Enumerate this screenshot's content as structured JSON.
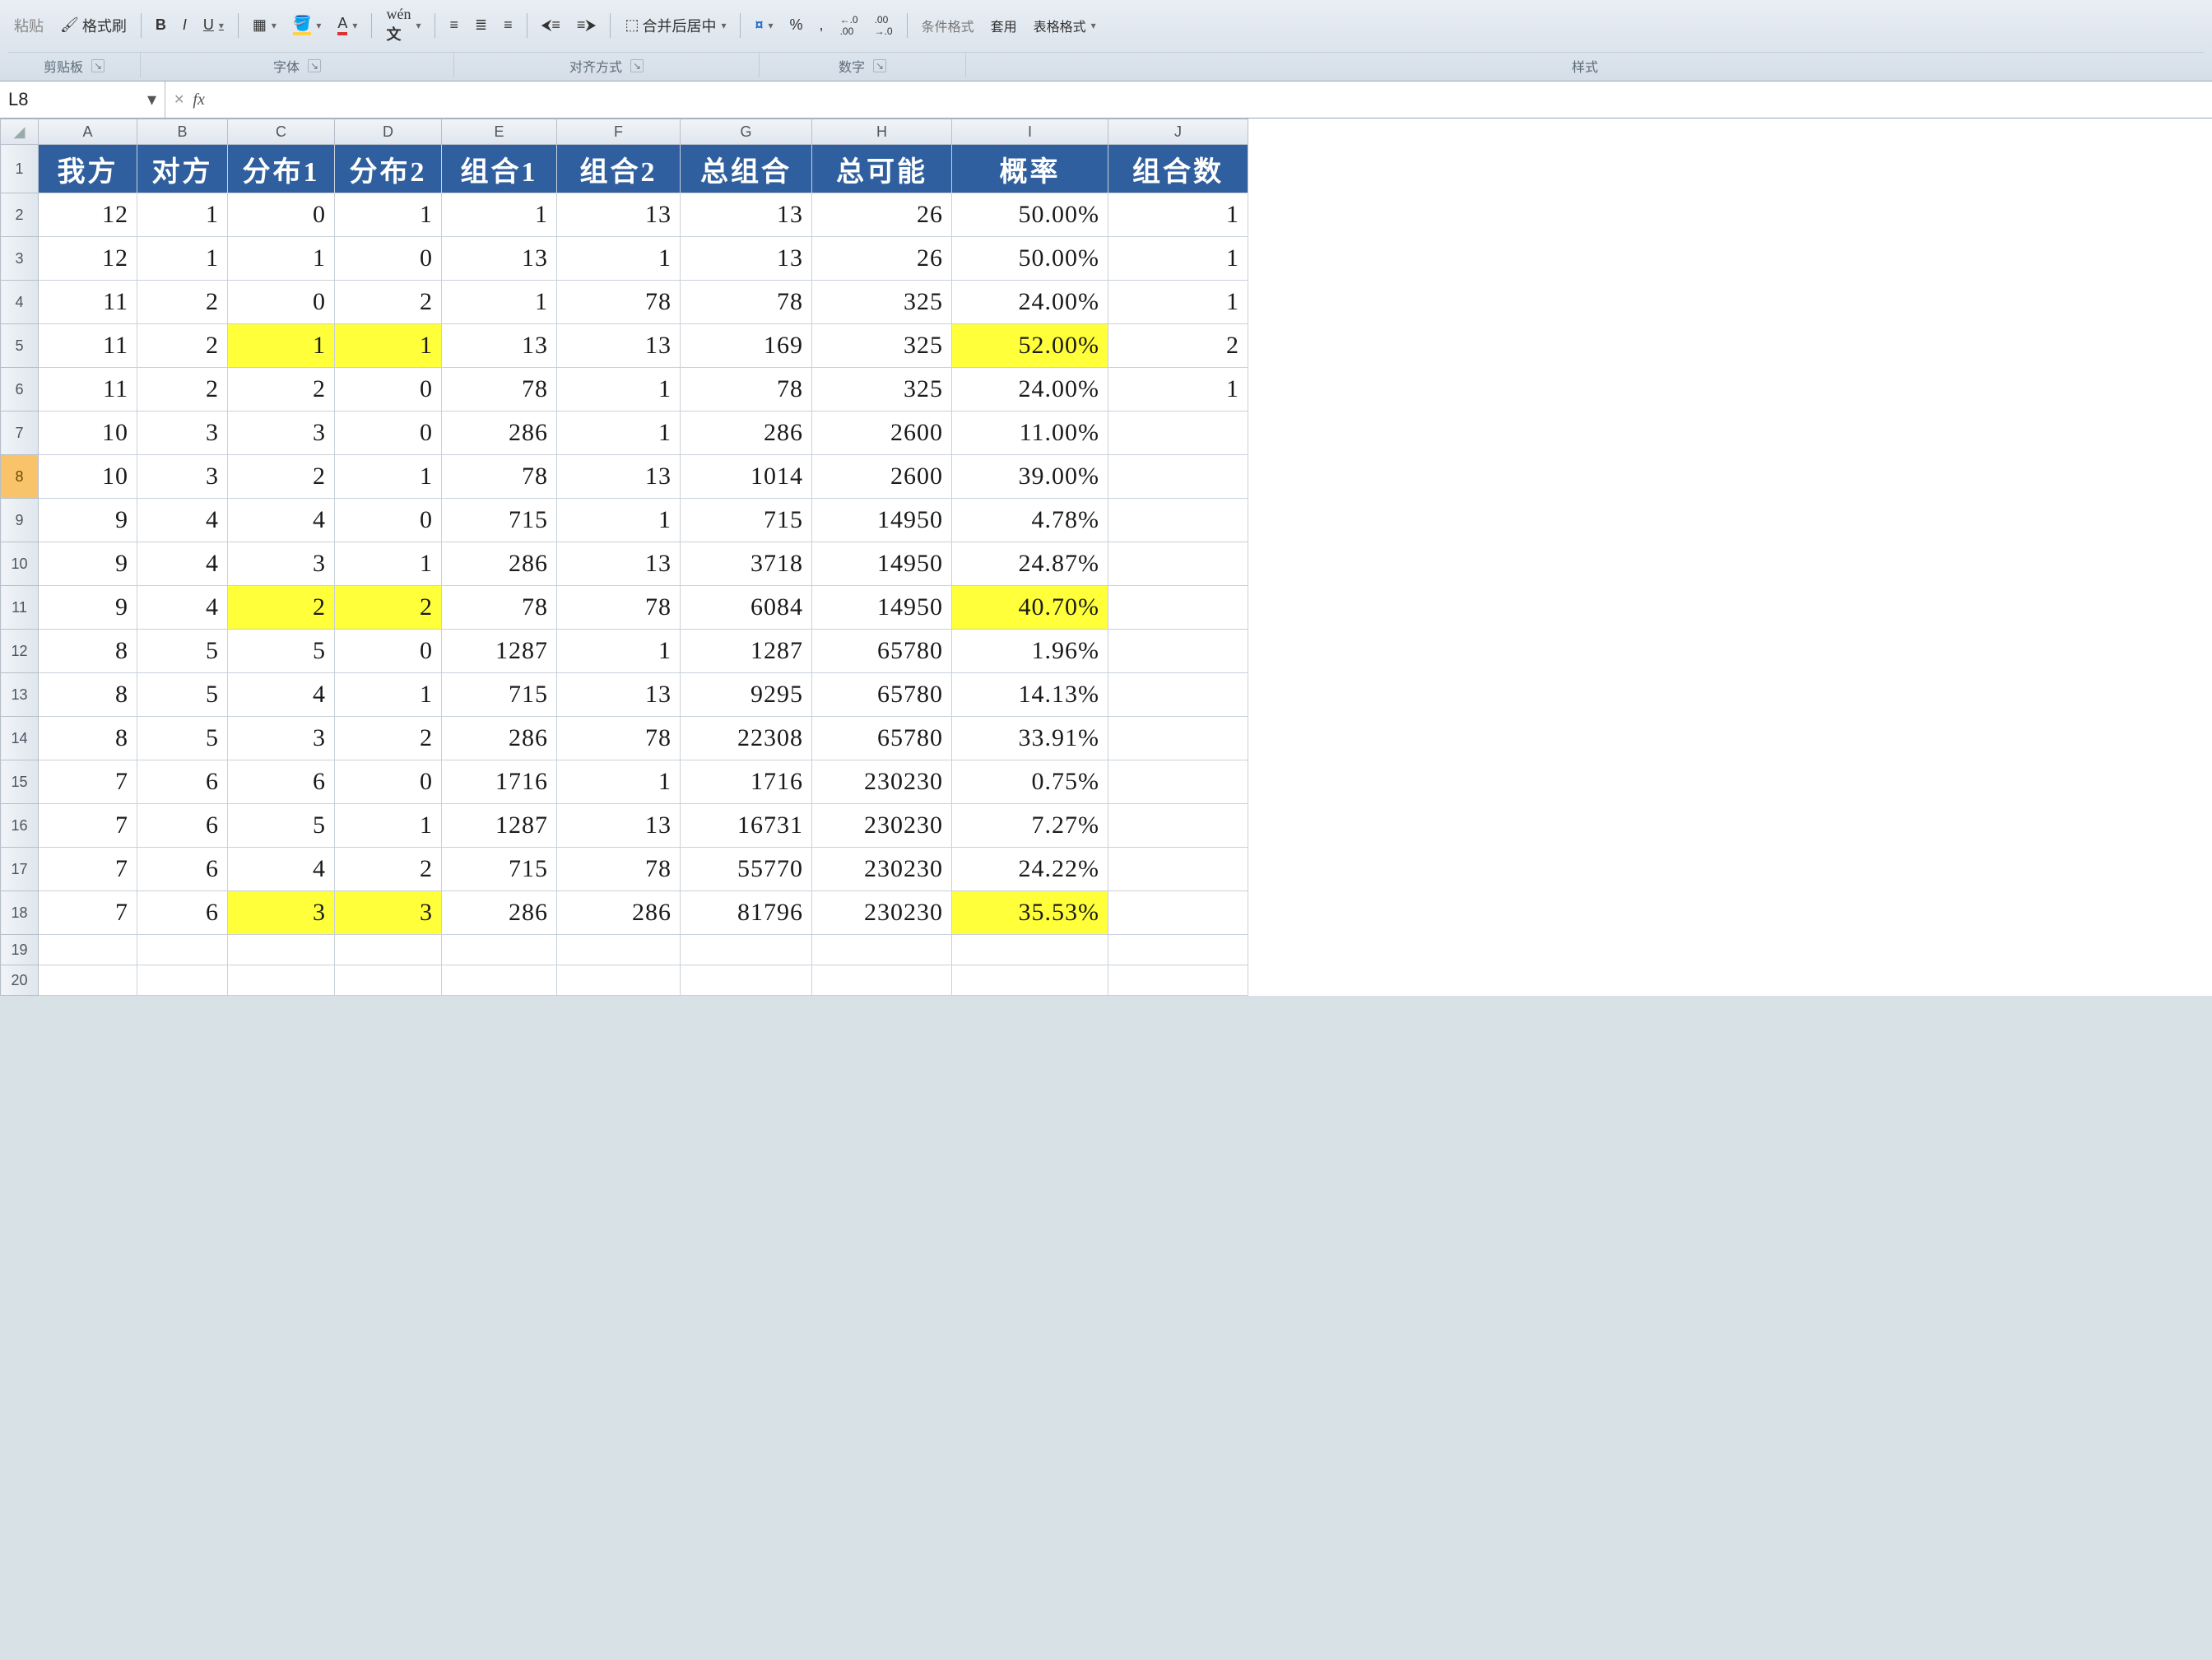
{
  "ribbon": {
    "paste_group_hint": "粘贴",
    "format_painter": "格式刷",
    "merge_center": "合并后居中",
    "table_format": "表格格式",
    "table_apply": "套用",
    "cond_format": "条件格式",
    "groups": {
      "clipboard": "剪贴板",
      "font": "字体",
      "alignment": "对齐方式",
      "number": "数字",
      "styles": "样式"
    },
    "font_buttons": {
      "bold": "B",
      "italic": "I",
      "underline": "U"
    },
    "percent": "%",
    "comma": ",",
    "decimal_inc": ".00",
    "decimal_dec": ".0"
  },
  "namebox": {
    "ref": "L8",
    "formula": ""
  },
  "columns": [
    "A",
    "B",
    "C",
    "D",
    "E",
    "F",
    "G",
    "H",
    "I",
    "J"
  ],
  "headers": {
    "A": "我方",
    "B": "对方",
    "C": "分布1",
    "D": "分布2",
    "E": "组合1",
    "F": "组合2",
    "G": "总组合",
    "H": "总可能",
    "I": "概率",
    "J": "组合数"
  },
  "active_row": 8,
  "rows": [
    {
      "r": 2,
      "A": "12",
      "B": "1",
      "C": "0",
      "D": "1",
      "E": "1",
      "F": "13",
      "G": "13",
      "H": "26",
      "I": "50.00%",
      "J": "1"
    },
    {
      "r": 3,
      "A": "12",
      "B": "1",
      "C": "1",
      "D": "0",
      "E": "13",
      "F": "1",
      "G": "13",
      "H": "26",
      "I": "50.00%",
      "J": "1"
    },
    {
      "r": 4,
      "A": "11",
      "B": "2",
      "C": "0",
      "D": "2",
      "E": "1",
      "F": "78",
      "G": "78",
      "H": "325",
      "I": "24.00%",
      "J": "1"
    },
    {
      "r": 5,
      "A": "11",
      "B": "2",
      "C": "1",
      "D": "1",
      "E": "13",
      "F": "13",
      "G": "169",
      "H": "325",
      "I": "52.00%",
      "J": "2",
      "hl": [
        "C",
        "D",
        "I"
      ]
    },
    {
      "r": 6,
      "A": "11",
      "B": "2",
      "C": "2",
      "D": "0",
      "E": "78",
      "F": "1",
      "G": "78",
      "H": "325",
      "I": "24.00%",
      "J": "1"
    },
    {
      "r": 7,
      "A": "10",
      "B": "3",
      "C": "3",
      "D": "0",
      "E": "286",
      "F": "1",
      "G": "286",
      "H": "2600",
      "I": "11.00%",
      "J": ""
    },
    {
      "r": 8,
      "A": "10",
      "B": "3",
      "C": "2",
      "D": "1",
      "E": "78",
      "F": "13",
      "G": "1014",
      "H": "2600",
      "I": "39.00%",
      "J": ""
    },
    {
      "r": 9,
      "A": "9",
      "B": "4",
      "C": "4",
      "D": "0",
      "E": "715",
      "F": "1",
      "G": "715",
      "H": "14950",
      "I": "4.78%",
      "J": ""
    },
    {
      "r": 10,
      "A": "9",
      "B": "4",
      "C": "3",
      "D": "1",
      "E": "286",
      "F": "13",
      "G": "3718",
      "H": "14950",
      "I": "24.87%",
      "J": ""
    },
    {
      "r": 11,
      "A": "9",
      "B": "4",
      "C": "2",
      "D": "2",
      "E": "78",
      "F": "78",
      "G": "6084",
      "H": "14950",
      "I": "40.70%",
      "J": "",
      "hl": [
        "C",
        "D",
        "I"
      ]
    },
    {
      "r": 12,
      "A": "8",
      "B": "5",
      "C": "5",
      "D": "0",
      "E": "1287",
      "F": "1",
      "G": "1287",
      "H": "65780",
      "I": "1.96%",
      "J": ""
    },
    {
      "r": 13,
      "A": "8",
      "B": "5",
      "C": "4",
      "D": "1",
      "E": "715",
      "F": "13",
      "G": "9295",
      "H": "65780",
      "I": "14.13%",
      "J": ""
    },
    {
      "r": 14,
      "A": "8",
      "B": "5",
      "C": "3",
      "D": "2",
      "E": "286",
      "F": "78",
      "G": "22308",
      "H": "65780",
      "I": "33.91%",
      "J": ""
    },
    {
      "r": 15,
      "A": "7",
      "B": "6",
      "C": "6",
      "D": "0",
      "E": "1716",
      "F": "1",
      "G": "1716",
      "H": "230230",
      "I": "0.75%",
      "J": ""
    },
    {
      "r": 16,
      "A": "7",
      "B": "6",
      "C": "5",
      "D": "1",
      "E": "1287",
      "F": "13",
      "G": "16731",
      "H": "230230",
      "I": "7.27%",
      "J": ""
    },
    {
      "r": 17,
      "A": "7",
      "B": "6",
      "C": "4",
      "D": "2",
      "E": "715",
      "F": "78",
      "G": "55770",
      "H": "230230",
      "I": "24.22%",
      "J": ""
    },
    {
      "r": 18,
      "A": "7",
      "B": "6",
      "C": "3",
      "D": "3",
      "E": "286",
      "F": "286",
      "G": "81796",
      "H": "230230",
      "I": "35.53%",
      "J": "",
      "hl": [
        "C",
        "D",
        "I"
      ]
    }
  ],
  "empty_rows": [
    19,
    20
  ]
}
